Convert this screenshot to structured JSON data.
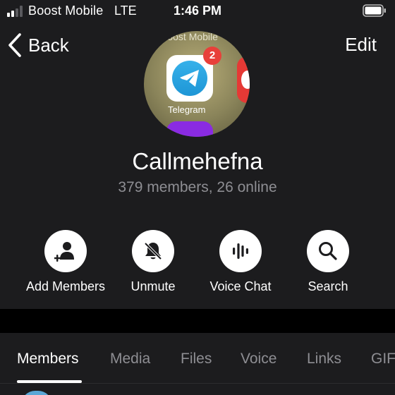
{
  "status_bar": {
    "carrier": "Boost Mobile",
    "network": "LTE",
    "time": "1:46 PM",
    "signal_bars_filled": 2,
    "signal_bars_total": 4
  },
  "nav": {
    "back_label": "Back",
    "edit_label": "Edit"
  },
  "avatar": {
    "top_text": "Boost Mobile",
    "app_label": "Telegram",
    "badge_count": "2"
  },
  "group": {
    "name": "Callmehefna",
    "subtitle": "379 members, 26 online"
  },
  "actions": [
    {
      "label": "Add Members",
      "icon": "add-member-icon"
    },
    {
      "label": "Unmute",
      "icon": "bell-muted-icon"
    },
    {
      "label": "Voice Chat",
      "icon": "voice-wave-icon"
    },
    {
      "label": "Search",
      "icon": "search-icon"
    }
  ],
  "tabs": [
    {
      "label": "Members",
      "active": true
    },
    {
      "label": "Media",
      "active": false
    },
    {
      "label": "Files",
      "active": false
    },
    {
      "label": "Voice",
      "active": false
    },
    {
      "label": "Links",
      "active": false
    },
    {
      "label": "GIF",
      "active": false
    }
  ],
  "colors": {
    "background": "#1c1c1e",
    "separator": "#000000",
    "secondary_text": "#8e8e93",
    "badge": "#e8403a",
    "telegram_blue": "#2aa3df"
  }
}
